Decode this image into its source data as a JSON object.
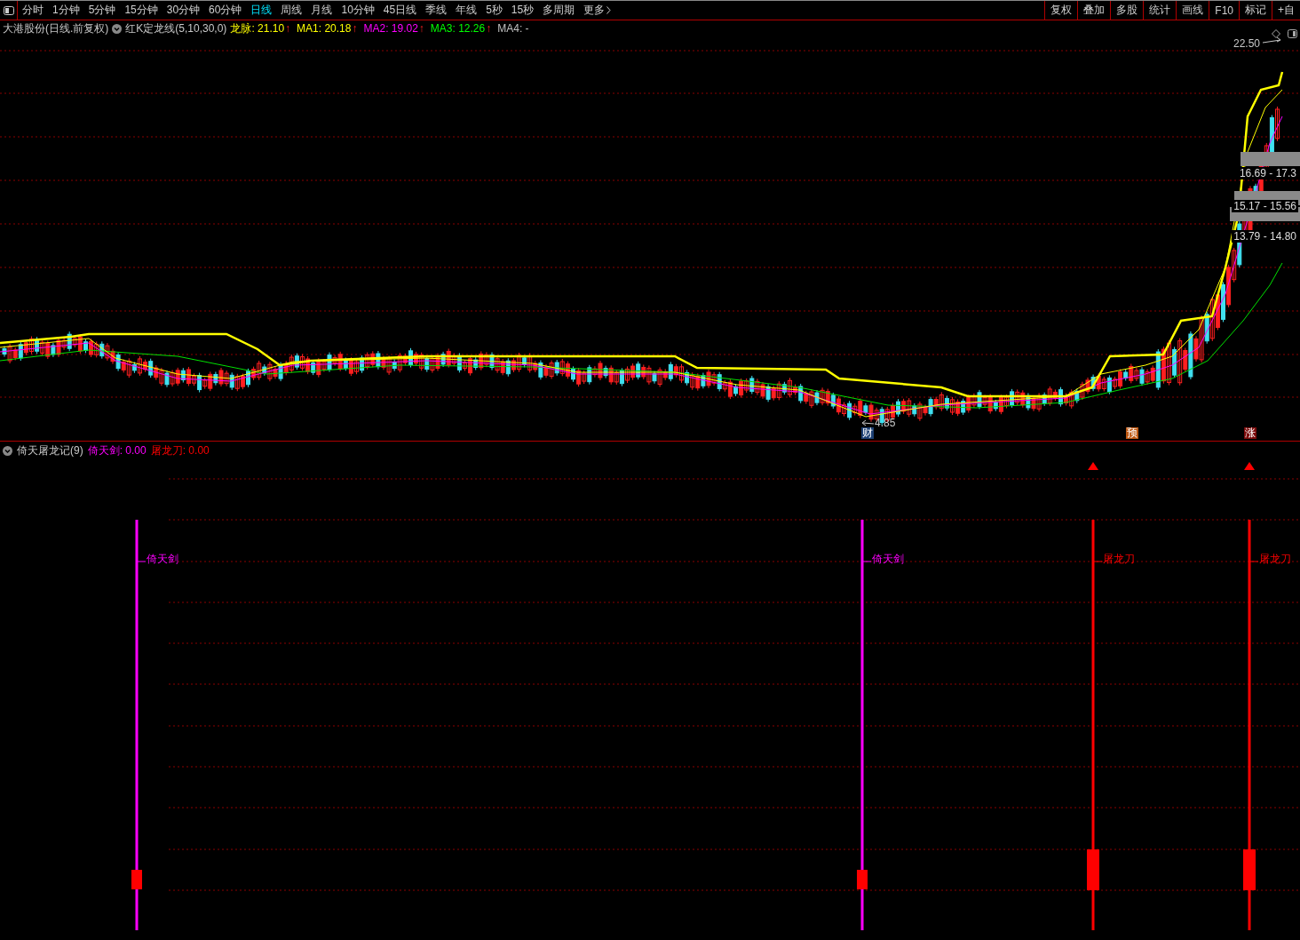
{
  "toolbar": {
    "periods": [
      {
        "label": "分时",
        "selected": false
      },
      {
        "label": "1分钟",
        "selected": false
      },
      {
        "label": "5分钟",
        "selected": false
      },
      {
        "label": "15分钟",
        "selected": false
      },
      {
        "label": "30分钟",
        "selected": false
      },
      {
        "label": "60分钟",
        "selected": false
      },
      {
        "label": "日线",
        "selected": true
      },
      {
        "label": "周线",
        "selected": false
      },
      {
        "label": "月线",
        "selected": false
      },
      {
        "label": "10分钟",
        "selected": false
      },
      {
        "label": "45日线",
        "selected": false
      },
      {
        "label": "季线",
        "selected": false
      },
      {
        "label": "年线",
        "selected": false
      },
      {
        "label": "5秒",
        "selected": false
      },
      {
        "label": "15秒",
        "selected": false
      },
      {
        "label": "多周期",
        "selected": false
      },
      {
        "label": "更多",
        "selected": false
      }
    ],
    "tools": [
      "复权",
      "叠加",
      "多股",
      "统计",
      "画线",
      "F10",
      "标记",
      "+自"
    ]
  },
  "info": {
    "stock": "大港股份(日线.前复权)",
    "indicator": "红K定龙线(5,10,30,0)",
    "legend": [
      {
        "text": "龙脉: 21.10",
        "color": "#ffff00",
        "arrow": "↑"
      },
      {
        "text": "MA1: 20.18",
        "color": "#ffff00",
        "arrow": "↑"
      },
      {
        "text": "MA2: 19.02",
        "color": "#ff00ff",
        "arrow": "↑"
      },
      {
        "text": "MA3: 12.26",
        "color": "#00ff00",
        "arrow": "↑"
      },
      {
        "text": "MA4: -",
        "color": "#c0c0c0"
      }
    ]
  },
  "price_chart": {
    "high_label": "22.50",
    "low_label": "4.85",
    "ranges": [
      "16.69 - 17.3",
      "15.17 - 15.56",
      "13.79 - 14.80"
    ],
    "markers": [
      {
        "label": "财",
        "color": "#1c3f73"
      },
      {
        "label": "预",
        "color": "#c05a14"
      },
      {
        "label": "涨",
        "color": "#7a0a0a"
      }
    ]
  },
  "indicator_panel": {
    "title": "倚天屠龙记(9)",
    "values": [
      {
        "text": "倚天剑: 0.00",
        "color": "#ff00ff"
      },
      {
        "text": "屠龙刀: 0.00",
        "color": "#ff0000"
      }
    ],
    "signals": [
      {
        "label": "倚天剑",
        "color": "#ff00ff",
        "triangle": false
      },
      {
        "label": "倚天剑",
        "color": "#ff00ff",
        "triangle": false
      },
      {
        "label": "屠龙刀",
        "color": "#ff0000",
        "triangle": true
      },
      {
        "label": "屠龙刀",
        "color": "#ff0000",
        "triangle": true
      }
    ]
  }
}
